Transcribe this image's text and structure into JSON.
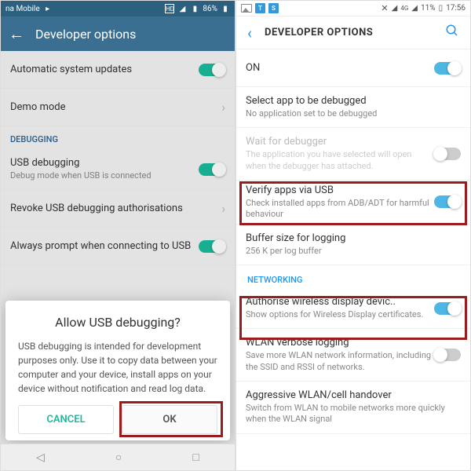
{
  "left": {
    "status": {
      "carrier": "na Mobile",
      "signal": "86%",
      "hd": "HD"
    },
    "header": {
      "title": "Developer options"
    },
    "items": [
      {
        "primary": "Automatic system updates",
        "toggle": "on"
      },
      {
        "primary": "Demo mode",
        "chevron": true
      },
      {
        "section": "DEBUGGING"
      },
      {
        "primary": "USB debugging",
        "secondary": "Debug mode when USB is connected",
        "toggle": "on"
      },
      {
        "primary": "Revoke USB debugging authorisations",
        "chevron": true
      },
      {
        "primary": "Always prompt when connecting to USB",
        "toggle": "on"
      }
    ],
    "dialog": {
      "title": "Allow USB debugging?",
      "body": "USB debugging is intended for development purposes only. Use it to copy data between your computer and your device, install apps on your device without notification and read log data.",
      "cancel": "CANCEL",
      "ok": "OK"
    }
  },
  "right": {
    "status": {
      "battery": "11%",
      "time": "17:56"
    },
    "header": {
      "title": "DEVELOPER OPTIONS"
    },
    "items": [
      {
        "primary": "ON",
        "toggle": "on"
      },
      {
        "primary": "Select app to be debugged",
        "secondary": "No application set to be debugged"
      },
      {
        "primary": "Wait for debugger",
        "secondary": "The application you have selected will open when the debugger has attached.",
        "disabled": true,
        "toggle": "off"
      },
      {
        "primary": "Verify apps via USB",
        "secondary": "Check installed apps from ADB/ADT for harmful behaviour",
        "toggle": "on",
        "highlight": true
      },
      {
        "primary": "Buffer size for logging",
        "secondary": "256 K per log buffer"
      },
      {
        "section": "NETWORKING"
      },
      {
        "primary": "Authorise wireless display devic..",
        "secondary": "Show options for Wireless Display certificates.",
        "toggle": "on",
        "highlight": true
      },
      {
        "primary": "WLAN verbose logging",
        "secondary": "Save more WLAN network information, including the SSID and RSSI of networks.",
        "toggle": "off"
      },
      {
        "primary": "Aggressive WLAN/cell handover",
        "secondary": "Switch from WLAN to mobile networks more quickly when the WLAN signal"
      }
    ]
  }
}
